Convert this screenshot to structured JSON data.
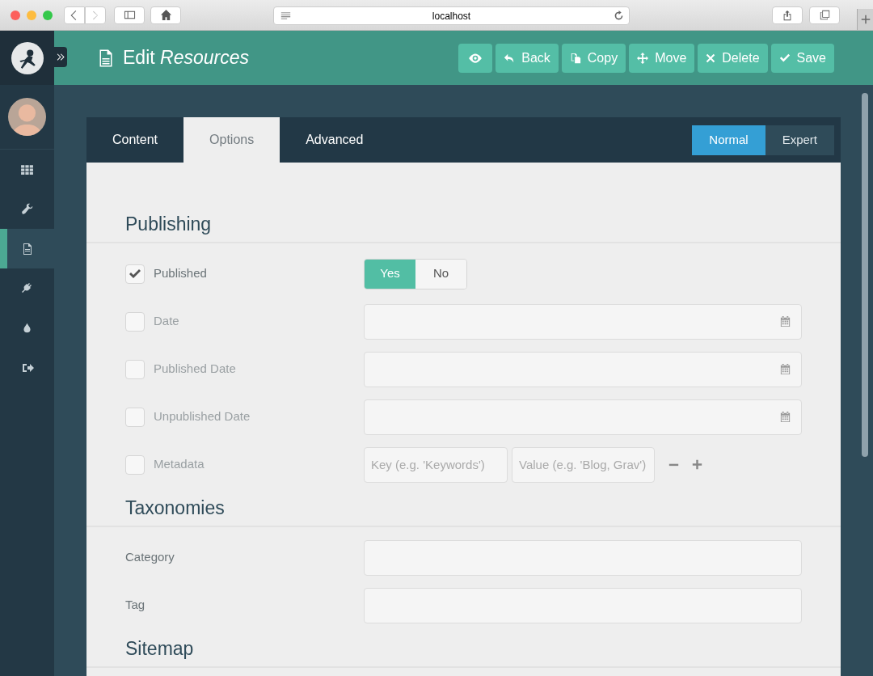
{
  "browser": {
    "url": "localhost"
  },
  "header": {
    "title": "Edit *Resources*",
    "actions": [
      {
        "kind": "eye"
      },
      {
        "kind": "back",
        "label": "Back"
      },
      {
        "kind": "copy",
        "label": "Copy"
      },
      {
        "kind": "move",
        "label": "Move"
      },
      {
        "kind": "delete",
        "label": "Delete"
      },
      {
        "kind": "save",
        "label": "Save"
      }
    ]
  },
  "sidebar": {
    "items": [
      {
        "kind": "dashboard",
        "selected": false
      },
      {
        "kind": "configuration",
        "selected": false
      },
      {
        "kind": "pages",
        "selected": true
      },
      {
        "kind": "plugins",
        "selected": false
      },
      {
        "kind": "themes",
        "selected": false
      },
      {
        "kind": "logout",
        "selected": false
      }
    ]
  },
  "tabs": [
    {
      "label": "Content",
      "selected": false
    },
    {
      "label": "Options",
      "selected": true
    },
    {
      "label": "Advanced",
      "selected": false
    }
  ],
  "modes": [
    {
      "label": "Normal",
      "selected": true
    },
    {
      "label": "Expert",
      "selected": false
    }
  ],
  "sections": [
    {
      "title": "Publishing",
      "fields": [
        {
          "kind": "toggle",
          "label": "Published",
          "checked": true,
          "options": [
            {
              "label": "Yes",
              "selected": true
            },
            {
              "label": "No",
              "selected": false
            }
          ]
        },
        {
          "kind": "date",
          "label": "Date",
          "checked": false
        },
        {
          "kind": "date",
          "label": "Published Date",
          "checked": false
        },
        {
          "kind": "date",
          "label": "Unpublished Date",
          "checked": false
        },
        {
          "kind": "metadata",
          "label": "Metadata",
          "checked": false,
          "key_placeholder": "Key (e.g. 'Keywords')",
          "value_placeholder": "Value (e.g. 'Blog, Grav')"
        }
      ]
    },
    {
      "title": "Taxonomies",
      "fields": [
        {
          "kind": "text",
          "label": "Category"
        },
        {
          "kind": "text",
          "label": "Tag"
        }
      ]
    },
    {
      "title": "Sitemap"
    }
  ]
}
